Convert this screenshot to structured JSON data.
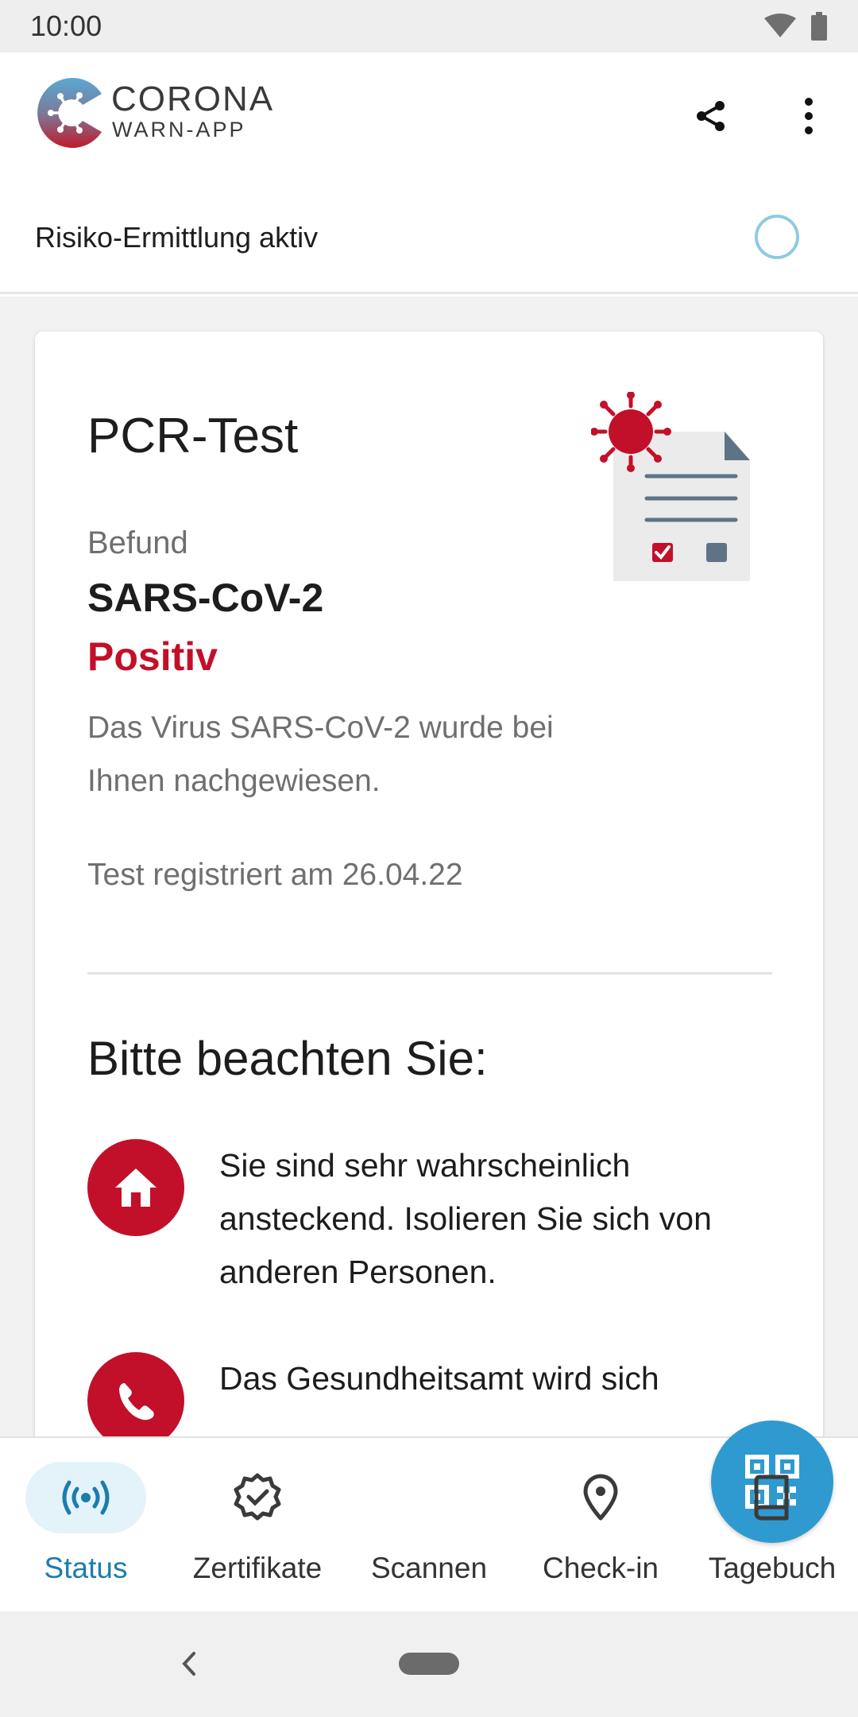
{
  "status_bar": {
    "time": "10:00"
  },
  "app": {
    "name_line1": "CORONA",
    "name_line2": "WARN-APP"
  },
  "risk": {
    "label": "Risiko-Ermittlung aktiv"
  },
  "test_card": {
    "title": "PCR-Test",
    "finding_label": "Befund",
    "finding_name": "SARS-CoV-2",
    "finding_result": "Positiv",
    "description": "Das Virus SARS-CoV-2 wurde bei Ihnen nachgewiesen.",
    "registered": "Test registriert am 26.04.22",
    "notice_title": "Bitte beachten Sie:",
    "notices": [
      {
        "icon": "home-icon",
        "text": "Sie sind sehr wahrscheinlich ansteckend. Isolieren Sie sich von anderen Personen."
      },
      {
        "icon": "phone-icon",
        "text": "Das Gesundheitsamt wird sich"
      }
    ]
  },
  "bottom_nav": {
    "items": [
      {
        "label": "Status",
        "icon": "status-broadcast-icon",
        "active": true
      },
      {
        "label": "Zertifikate",
        "icon": "certificate-badge-icon"
      },
      {
        "label": "Scannen",
        "icon": "qr-code-icon"
      },
      {
        "label": "Check-in",
        "icon": "location-pin-icon"
      },
      {
        "label": "Tagebuch",
        "icon": "book-icon"
      }
    ]
  },
  "colors": {
    "accent_blue": "#2f9ad0",
    "active_blue": "#1b7dab",
    "positive_red": "#c2102a",
    "ring_blue": "#8dcbe0"
  }
}
